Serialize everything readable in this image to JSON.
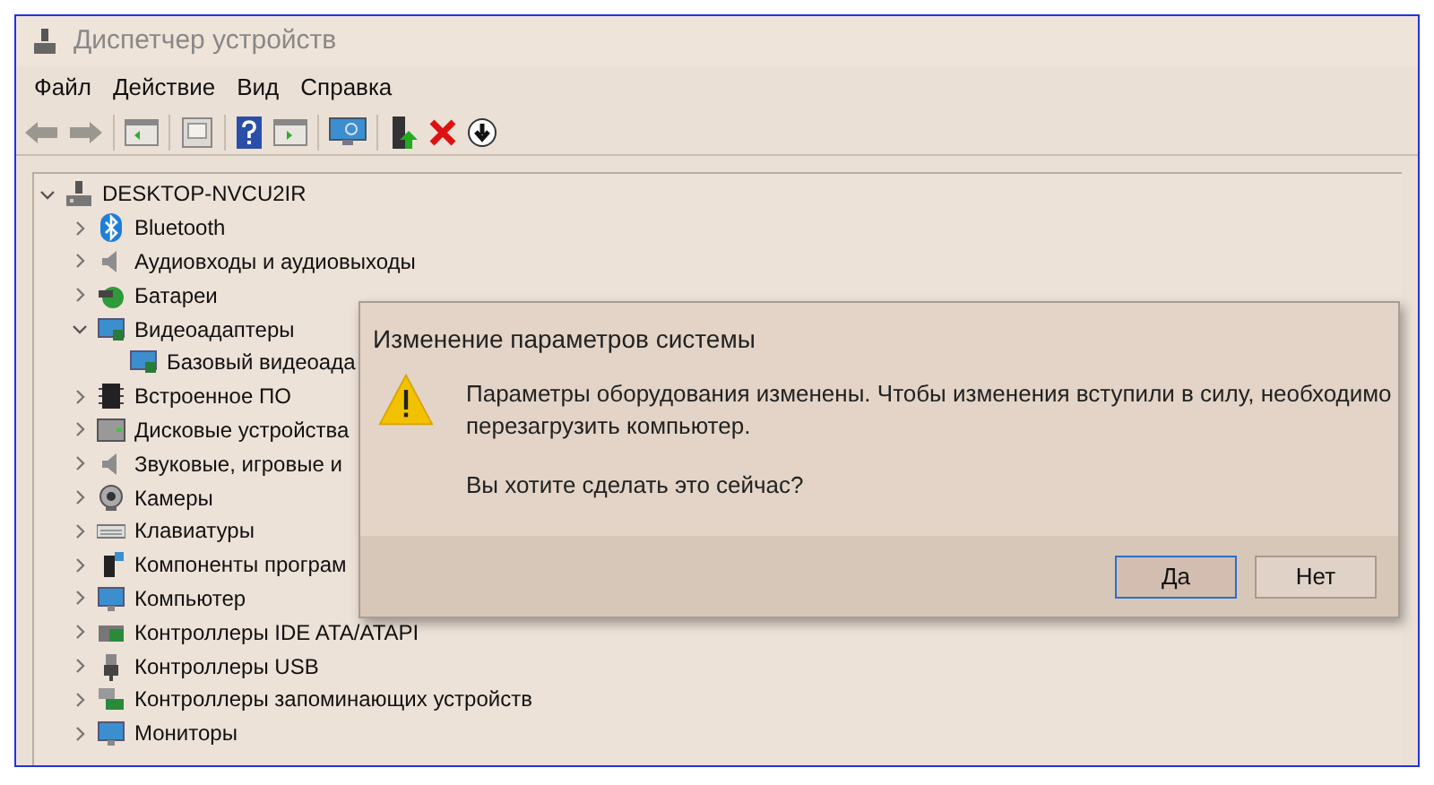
{
  "window": {
    "title": "Диспетчер устройств"
  },
  "menu": [
    {
      "label": "Файл"
    },
    {
      "label": "Действие"
    },
    {
      "label": "Вид"
    },
    {
      "label": "Справка"
    }
  ],
  "tree": {
    "label": "DESKTOP-NVCU2IR",
    "expanded": true,
    "children": [
      {
        "label": "Bluetooth",
        "expanded": false
      },
      {
        "label": "Аудиовходы и аудиовыходы",
        "expanded": false
      },
      {
        "label": "Батареи",
        "expanded": false
      },
      {
        "label": "Видеоадаптеры",
        "expanded": true,
        "children": [
          {
            "label": "Базовый видеоада"
          }
        ]
      },
      {
        "label": "Встроенное ПО",
        "expanded": false
      },
      {
        "label": "Дисковые устройства",
        "expanded": false
      },
      {
        "label": "Звуковые, игровые и",
        "expanded": false
      },
      {
        "label": "Камеры",
        "expanded": false
      },
      {
        "label": "Клавиатуры",
        "expanded": false
      },
      {
        "label": "Компоненты програм",
        "expanded": false
      },
      {
        "label": "Компьютер",
        "expanded": false
      },
      {
        "label": "Контроллеры IDE ATA/ATAPI",
        "expanded": false
      },
      {
        "label": "Контроллеры USB",
        "expanded": false
      },
      {
        "label": "Контроллеры запоминающих устройств",
        "expanded": false
      },
      {
        "label": "Мониторы",
        "expanded": false
      }
    ]
  },
  "dialog": {
    "title": "Изменение параметров системы",
    "message": "Параметры оборудования изменены. Чтобы изменения вступили в силу, необходимо перезагрузить компьютер.",
    "question": "Вы хотите сделать это сейчас?",
    "buttons": [
      {
        "label": "Да",
        "default": true
      },
      {
        "label": "Нет",
        "default": false
      }
    ]
  }
}
